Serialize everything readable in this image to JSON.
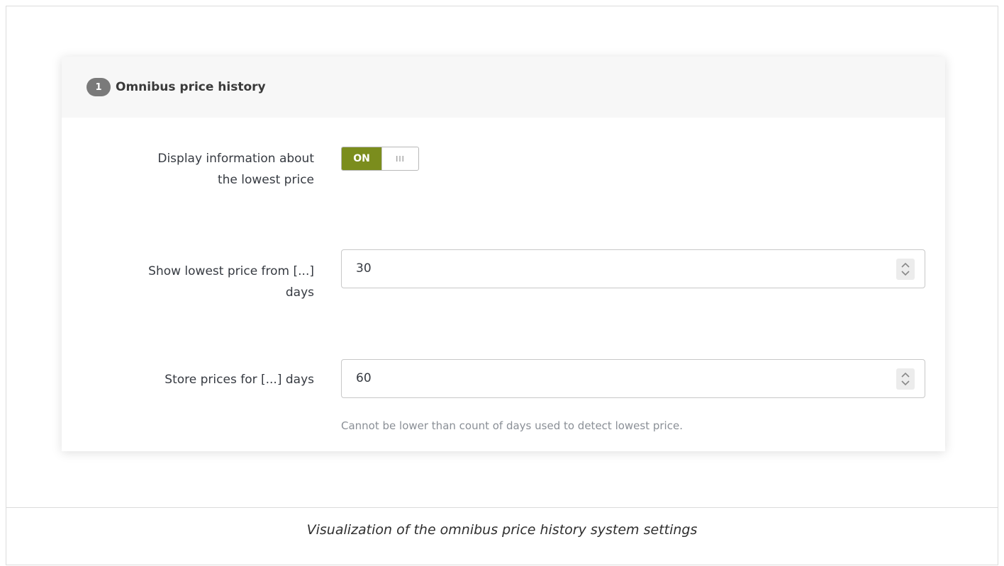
{
  "panel": {
    "step_number": "1",
    "title": "Omnibus price history"
  },
  "fields": {
    "display_lowest": {
      "label_line1": "Display information about",
      "label_line2": "the lowest price",
      "toggle_on_label": "ON",
      "toggle_handle_glyph": "III",
      "state": "on"
    },
    "show_from_days": {
      "label_line1": "Show lowest price from [...]",
      "label_line2": "days",
      "value": "30"
    },
    "store_days": {
      "label": "Store prices for [...] days",
      "value": "60",
      "help": "Cannot be lower than count of days used to detect lowest price."
    }
  },
  "caption": "Visualization of the omnibus price history system settings",
  "colors": {
    "toggle_on": "#7b8d1d",
    "badge": "#7a7a7a"
  }
}
